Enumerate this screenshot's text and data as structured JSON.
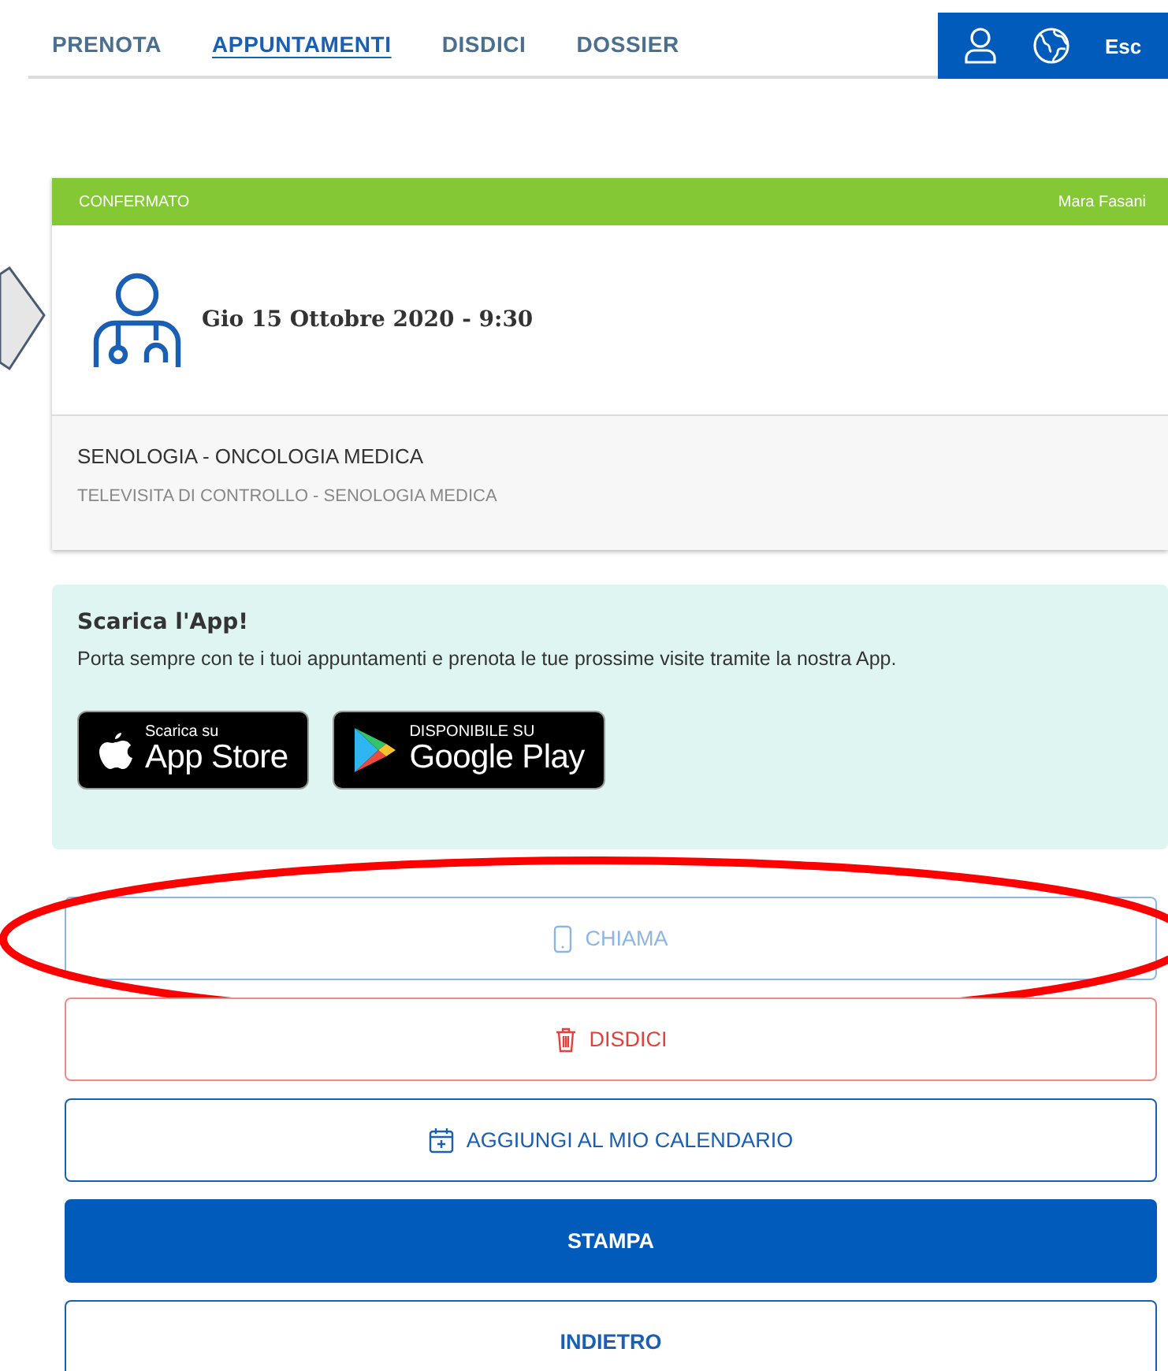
{
  "nav": {
    "tabs": [
      {
        "label": "PRENOTA",
        "selected": false
      },
      {
        "label": "APPUNTAMENTI",
        "selected": true
      },
      {
        "label": "DISDICI",
        "selected": false
      },
      {
        "label": "DOSSIER",
        "selected": false
      }
    ],
    "logout": "Esc"
  },
  "appointment": {
    "status": "CONFERMATO",
    "patient": "Mara Fasani",
    "datetime": "Gio 15 Ottobre 2020 - 9:30",
    "specialty": "SENOLOGIA - ONCOLOGIA MEDICA",
    "visit": "TELEVISITA DI CONTROLLO - SENOLOGIA MEDICA",
    "pointed": true
  },
  "app_promo": {
    "title": "Scarica l'App!",
    "text": "Porta sempre con te i tuoi appuntamenti e prenota le tue prossime visite tramite la nostra App.",
    "badges": [
      {
        "kind": "apple",
        "small": "Scarica su",
        "big": "App Store"
      },
      {
        "kind": "google",
        "small": "DISPONIBILE SU",
        "big": "Google Play"
      }
    ]
  },
  "actions": [
    {
      "kind": "call",
      "label": "CHIAMA",
      "disabled": true,
      "circled": true
    },
    {
      "kind": "cancel",
      "label": "DISDICI",
      "disabled": false,
      "circled": false
    },
    {
      "kind": "calendar",
      "label": "AGGIUNGI AL MIO CALENDARIO",
      "disabled": false,
      "circled": false
    },
    {
      "kind": "primary",
      "label": "STAMPA",
      "disabled": false,
      "circled": false
    },
    {
      "kind": "plain",
      "label": "INDIETRO",
      "disabled": false,
      "circled": false
    }
  ]
}
